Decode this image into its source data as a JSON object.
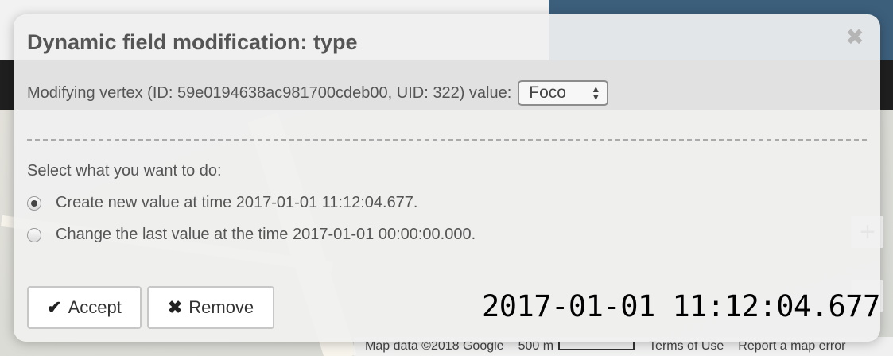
{
  "modal": {
    "title": "Dynamic field modification: type",
    "close_glyph": "✖",
    "vertex_label": "Modifying vertex (ID: 59e0194638ac981700cdeb00, UID: 322) value:",
    "type_select": {
      "selected": "Foco",
      "arrows_glyph_up": "▲",
      "arrows_glyph_down": "▼"
    },
    "prompt": "Select what you want to do:",
    "options": [
      {
        "label": "Create new value at time 2017-01-01 11:12:04.677.",
        "selected": true
      },
      {
        "label": "Change the last value at the time 2017-01-01 00:00:00.000.",
        "selected": false
      }
    ],
    "accept_label": "Accept",
    "accept_icon": "✔",
    "remove_label": "Remove",
    "remove_icon": "✖",
    "timestamp": "2017-01-01 11:12:04.677"
  },
  "map_footer": {
    "map_data": "Map data ©2018 Google",
    "scale": "500 m",
    "terms": "Terms of Use",
    "report": "Report a map error"
  },
  "map_controls": {
    "zoom_in": "+",
    "zoom_out": "−"
  },
  "colors": {
    "modal_bg": "#f0f0f0",
    "title_text": "#555555",
    "body_text": "#555555",
    "timestamp_text": "#000000"
  },
  "icons": [
    "close-icon",
    "check-icon",
    "times-icon",
    "select-arrows-icon"
  ]
}
